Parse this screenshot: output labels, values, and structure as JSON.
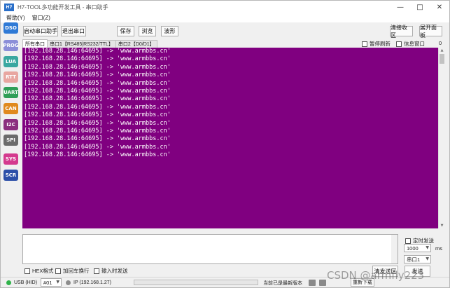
{
  "window": {
    "title": "H7-TOOL多功能开发工具 - 串口助手",
    "icon_text": "H7",
    "controls": [
      "—",
      "□",
      "✕"
    ]
  },
  "menu": [
    "帮助(Y)",
    "窗口(Z)"
  ],
  "sidebar": [
    {
      "label": "DSO",
      "color": "#2f7ad6"
    },
    {
      "label": "PROG",
      "color": "#8c8fd8"
    },
    {
      "label": "LUA",
      "color": "#3aa7a0"
    },
    {
      "label": "RTT",
      "color": "#e8a6a0"
    },
    {
      "label": "UART",
      "color": "#2f9e57"
    },
    {
      "label": "CAN",
      "color": "#e08a1e"
    },
    {
      "label": "I2C",
      "color": "#8b2f7f"
    },
    {
      "label": "SPI",
      "color": "#6b6b6b"
    },
    {
      "label": "SYS",
      "color": "#d43a8e"
    },
    {
      "label": "SCR",
      "color": "#2c4fa8"
    }
  ],
  "toolbar": {
    "start": "启动串口助手",
    "exit": "退出串口",
    "save": "保存",
    "browse": "浏览",
    "wave": "波形",
    "clear_recv": "清接收区",
    "expand": "展开面板"
  },
  "tabs": [
    "所有串口",
    "串口1【RS485|RS232/TTL】",
    "串口2【D0/D1】"
  ],
  "options": {
    "pause": "暂停刷新",
    "info": "信息窗口",
    "counter": "0"
  },
  "console": {
    "bg_color": "#800080",
    "lines": [
      "[192.168.28.146:64695] -> 'www.armbbs.cn'",
      "[192.168.28.146:64695] -> 'www.armbbs.cn'",
      "[192.168.28.146:64695] -> 'www.armbbs.cn'",
      "[192.168.28.146:64695] -> 'www.armbbs.cn'",
      "[192.168.28.146:64695] -> 'www.armbbs.cn'",
      "[192.168.28.146:64695] -> 'www.armbbs.cn'",
      "[192.168.28.146:64695] -> 'www.armbbs.cn'",
      "[192.168.28.146:64695] -> 'www.armbbs.cn'",
      "[192.168.28.146:64695] -> 'www.armbbs.cn'",
      "[192.168.28.146:64695] -> 'www.armbbs.cn'",
      "[192.168.28.146:64695] -> 'www.armbbs.cn'",
      "[192.168.28.146:64695] -> 'www.armbbs.cn'",
      "[192.168.28.146:64695] -> 'www.armbbs.cn'",
      "[192.168.28.146:64695] -> 'www.armbbs.cn'"
    ]
  },
  "send": {
    "timed_send": "定时发送",
    "interval_value": "1000",
    "interval_unit": "ms",
    "port_value": "串口1",
    "hex_format": "HEX格式",
    "add_crlf": "加回车换行",
    "input_send": "输入时发送",
    "clear_send": "清发送区",
    "send_button": "发送"
  },
  "status": {
    "usb": "USB (HID)",
    "usb_color": "#2fb34a",
    "device": "#01",
    "ip": "IP (192.168.1.27)",
    "ip_color": "#8c8c8c",
    "progress": 0,
    "version": "当前已是最新版本",
    "update": "重新下载",
    "watermark": "CSDN @armfly223"
  }
}
